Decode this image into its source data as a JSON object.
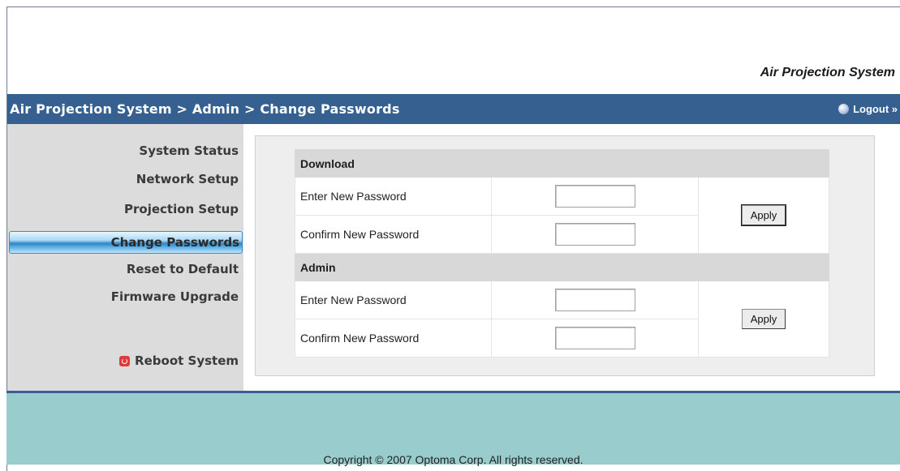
{
  "brand": {
    "title": "Air Projection System"
  },
  "topbar": {
    "breadcrumb": "Air Projection System > Admin > Change Passwords",
    "logout_label": "Logout »"
  },
  "sidebar": {
    "items": [
      {
        "label": "System Status"
      },
      {
        "label": "Network Setup"
      },
      {
        "label": "Projection Setup"
      },
      {
        "label": "Change Passwords",
        "active": true
      },
      {
        "label": "Reset to Default"
      },
      {
        "label": "Firmware Upgrade"
      }
    ],
    "reboot_label": "Reboot System"
  },
  "sections": [
    {
      "title": "Download",
      "fields": [
        {
          "label": "Enter New Password",
          "value": ""
        },
        {
          "label": "Confirm New Password",
          "value": ""
        }
      ],
      "apply_label": "Apply"
    },
    {
      "title": "Admin",
      "fields": [
        {
          "label": "Enter New Password",
          "value": ""
        },
        {
          "label": "Confirm New Password",
          "value": ""
        }
      ],
      "apply_label": "Apply"
    }
  ],
  "footer": {
    "copyright": "Copyright © 2007 Optoma Corp. All rights reserved."
  },
  "colors": {
    "header_bar": "#36608f",
    "sidebar_bg": "#dcdcdc",
    "footer_bg": "#99cccc",
    "section_header": "#d8d8d8"
  }
}
